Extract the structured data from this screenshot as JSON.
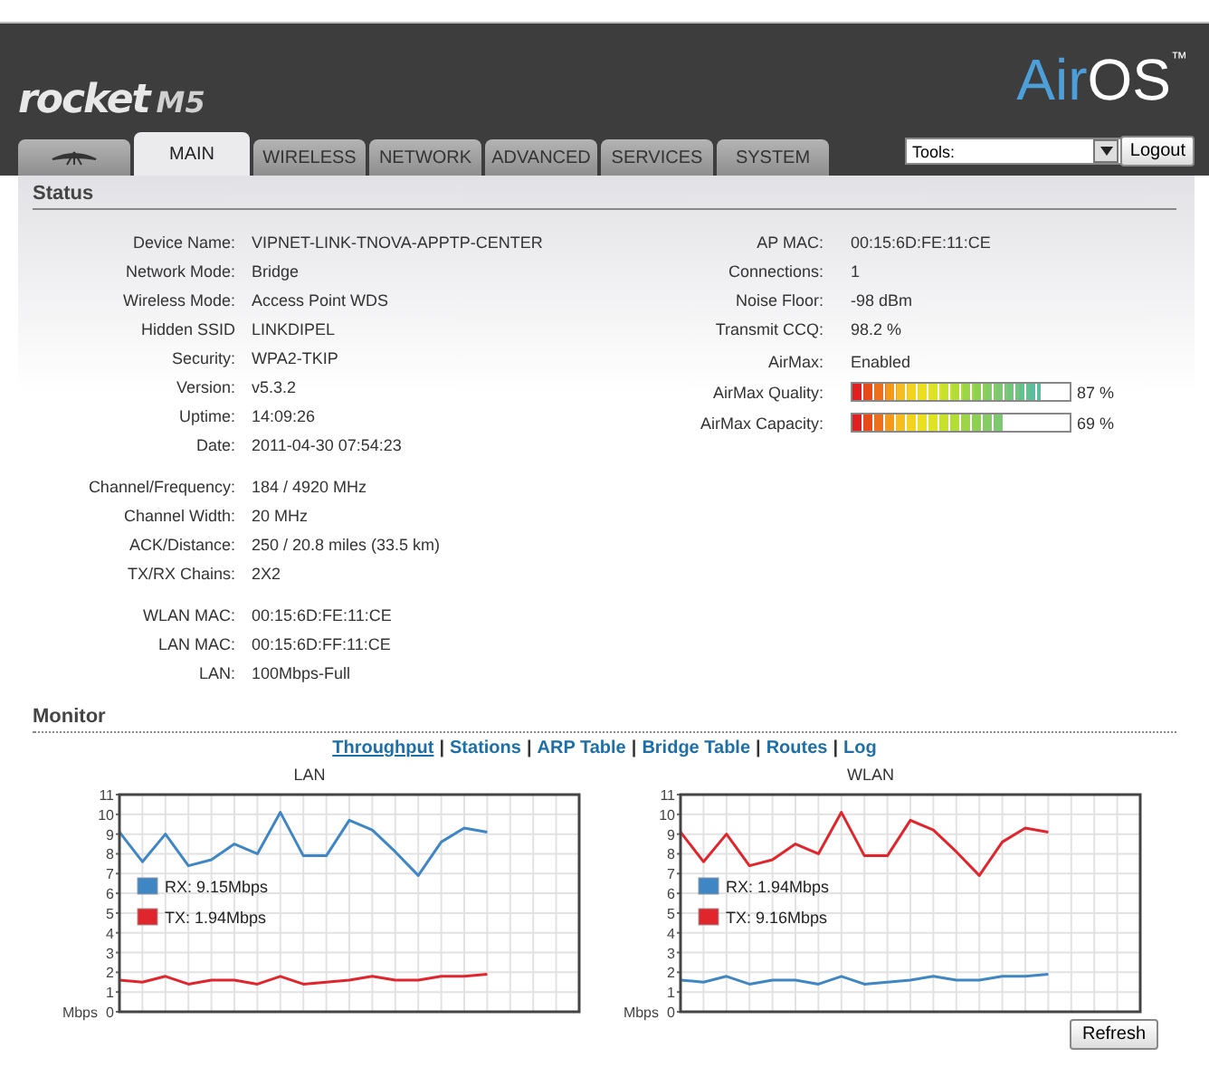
{
  "header": {
    "product": "rocket",
    "model": "M5",
    "os_logo": {
      "part_1": "Air",
      "part_2": "OS",
      "mark": "™"
    }
  },
  "tabs": [
    {
      "kind": "icon",
      "selected": false
    },
    {
      "kind": "text",
      "label": "MAIN",
      "selected": true
    },
    {
      "kind": "text",
      "label": "WIRELESS",
      "selected": false
    },
    {
      "kind": "text",
      "label": "NETWORK",
      "selected": false
    },
    {
      "kind": "text",
      "label": "ADVANCED",
      "selected": false
    },
    {
      "kind": "text",
      "label": "SERVICES",
      "selected": false
    },
    {
      "kind": "text",
      "label": "SYSTEM",
      "selected": false
    }
  ],
  "tools": {
    "value": "Tools:"
  },
  "logout_button": "Logout",
  "status": {
    "title": "Status",
    "left_groups": [
      [
        {
          "kind": "text",
          "label": "Device Name:",
          "value": "VIPNET-LINK-TNOVA-APPTP-CENTER"
        },
        {
          "kind": "text",
          "label": "Network Mode:",
          "value": "Bridge"
        },
        {
          "kind": "text",
          "label": "Wireless Mode:",
          "value": "Access Point WDS"
        },
        {
          "kind": "text",
          "label": "Hidden SSID",
          "value": "LINKDIPEL"
        },
        {
          "kind": "text",
          "label": "Security:",
          "value": "WPA2-TKIP"
        },
        {
          "kind": "text",
          "label": "Version:",
          "value": "v5.3.2"
        },
        {
          "kind": "text",
          "label": "Uptime:",
          "value": "14:09:26"
        },
        {
          "kind": "text",
          "label": "Date:",
          "value": "2011-04-30 07:54:23"
        }
      ],
      [
        {
          "kind": "text",
          "label": "Channel/Frequency:",
          "value": "184 / 4920 MHz"
        },
        {
          "kind": "text",
          "label": "Channel Width:",
          "value": "20 MHz"
        },
        {
          "kind": "text",
          "label": "ACK/Distance:",
          "value": "250 / 20.8 miles (33.5 km)"
        },
        {
          "kind": "text",
          "label": "TX/RX Chains:",
          "value": "2X2"
        }
      ],
      [
        {
          "kind": "text",
          "label": "WLAN MAC:",
          "value": "00:15:6D:FE:11:CE"
        },
        {
          "kind": "text",
          "label": "LAN MAC:",
          "value": "00:15:6D:FF:11:CE"
        },
        {
          "kind": "text",
          "label": "LAN:",
          "value": "100Mbps-Full"
        }
      ]
    ],
    "right_groups": [
      [
        {
          "kind": "text",
          "label": "AP MAC:",
          "value": "00:15:6D:FE:11:CE"
        },
        {
          "kind": "text",
          "label": "Connections:",
          "value": "1"
        },
        {
          "kind": "text",
          "label": "Noise Floor:",
          "value": "-98 dBm"
        },
        {
          "kind": "text",
          "label": "Transmit CCQ:",
          "value": "98.2 %"
        }
      ],
      [
        {
          "kind": "text",
          "label": "AirMax:",
          "value": "Enabled"
        },
        {
          "kind": "meter",
          "label": "AirMax Quality:",
          "level": 0.87,
          "reading": "87 %"
        },
        {
          "kind": "meter",
          "label": "AirMax Capacity:",
          "level": 0.69,
          "reading": "69 %"
        }
      ]
    ]
  },
  "monitor": {
    "title": "Monitor",
    "separator": "|",
    "links": [
      {
        "label": "Throughput",
        "selected": true
      },
      {
        "label": "Stations",
        "selected": false
      },
      {
        "label": "ARP Table",
        "selected": false
      },
      {
        "label": "Bridge Table",
        "selected": false
      },
      {
        "label": "Routes",
        "selected": false
      },
      {
        "label": "Log",
        "selected": false
      }
    ],
    "charts": [
      {
        "chart_data": {
          "type": "line",
          "title": "LAN",
          "grid": true,
          "legend": true,
          "ylabel": "Mbps",
          "ylim": [
            0,
            11
          ],
          "yticks": [
            0,
            1,
            2,
            3,
            4,
            5,
            6,
            7,
            8,
            9,
            10,
            11
          ],
          "categories": [
            null,
            null,
            null,
            null,
            null,
            null,
            null,
            null,
            null,
            null,
            null,
            null,
            null,
            null,
            null,
            null,
            null,
            null,
            null,
            null,
            null
          ],
          "series": [
            {
              "name": "RX: 9.15Mbps",
              "color": "#3f87c4",
              "values": [
                9.1,
                7.6,
                9.0,
                7.4,
                7.7,
                8.5,
                8.0,
                10.1,
                7.9,
                7.9,
                9.7,
                9.2,
                8.1,
                6.9,
                8.6,
                9.3,
                9.1,
                null,
                null,
                null,
                null
              ]
            },
            {
              "name": "TX: 1.94Mbps",
              "color": "#e0262c",
              "values": [
                1.6,
                1.5,
                1.8,
                1.4,
                1.6,
                1.6,
                1.4,
                1.8,
                1.4,
                1.5,
                1.6,
                1.8,
                1.6,
                1.6,
                1.8,
                1.8,
                1.9,
                null,
                null,
                null,
                null
              ]
            }
          ]
        }
      },
      {
        "chart_data": {
          "type": "line",
          "title": "WLAN",
          "grid": true,
          "legend": true,
          "ylabel": "Mbps",
          "ylim": [
            0,
            11
          ],
          "yticks": [
            0,
            1,
            2,
            3,
            4,
            5,
            6,
            7,
            8,
            9,
            10,
            11
          ],
          "categories": [
            null,
            null,
            null,
            null,
            null,
            null,
            null,
            null,
            null,
            null,
            null,
            null,
            null,
            null,
            null,
            null,
            null,
            null,
            null,
            null,
            null
          ],
          "series": [
            {
              "name": "RX: 1.94Mbps",
              "color": "#3f87c4",
              "values": [
                1.6,
                1.5,
                1.8,
                1.4,
                1.6,
                1.6,
                1.4,
                1.8,
                1.4,
                1.5,
                1.6,
                1.8,
                1.6,
                1.6,
                1.8,
                1.8,
                1.9,
                null,
                null,
                null,
                null
              ]
            },
            {
              "name": "TX: 9.16Mbps",
              "color": "#e0262c",
              "values": [
                9.1,
                7.6,
                9.0,
                7.4,
                7.7,
                8.5,
                8.0,
                10.1,
                7.9,
                7.9,
                9.7,
                9.2,
                8.1,
                6.9,
                8.6,
                9.3,
                9.1,
                null,
                null,
                null,
                null
              ]
            }
          ]
        }
      }
    ],
    "refresh_button": "Refresh"
  }
}
